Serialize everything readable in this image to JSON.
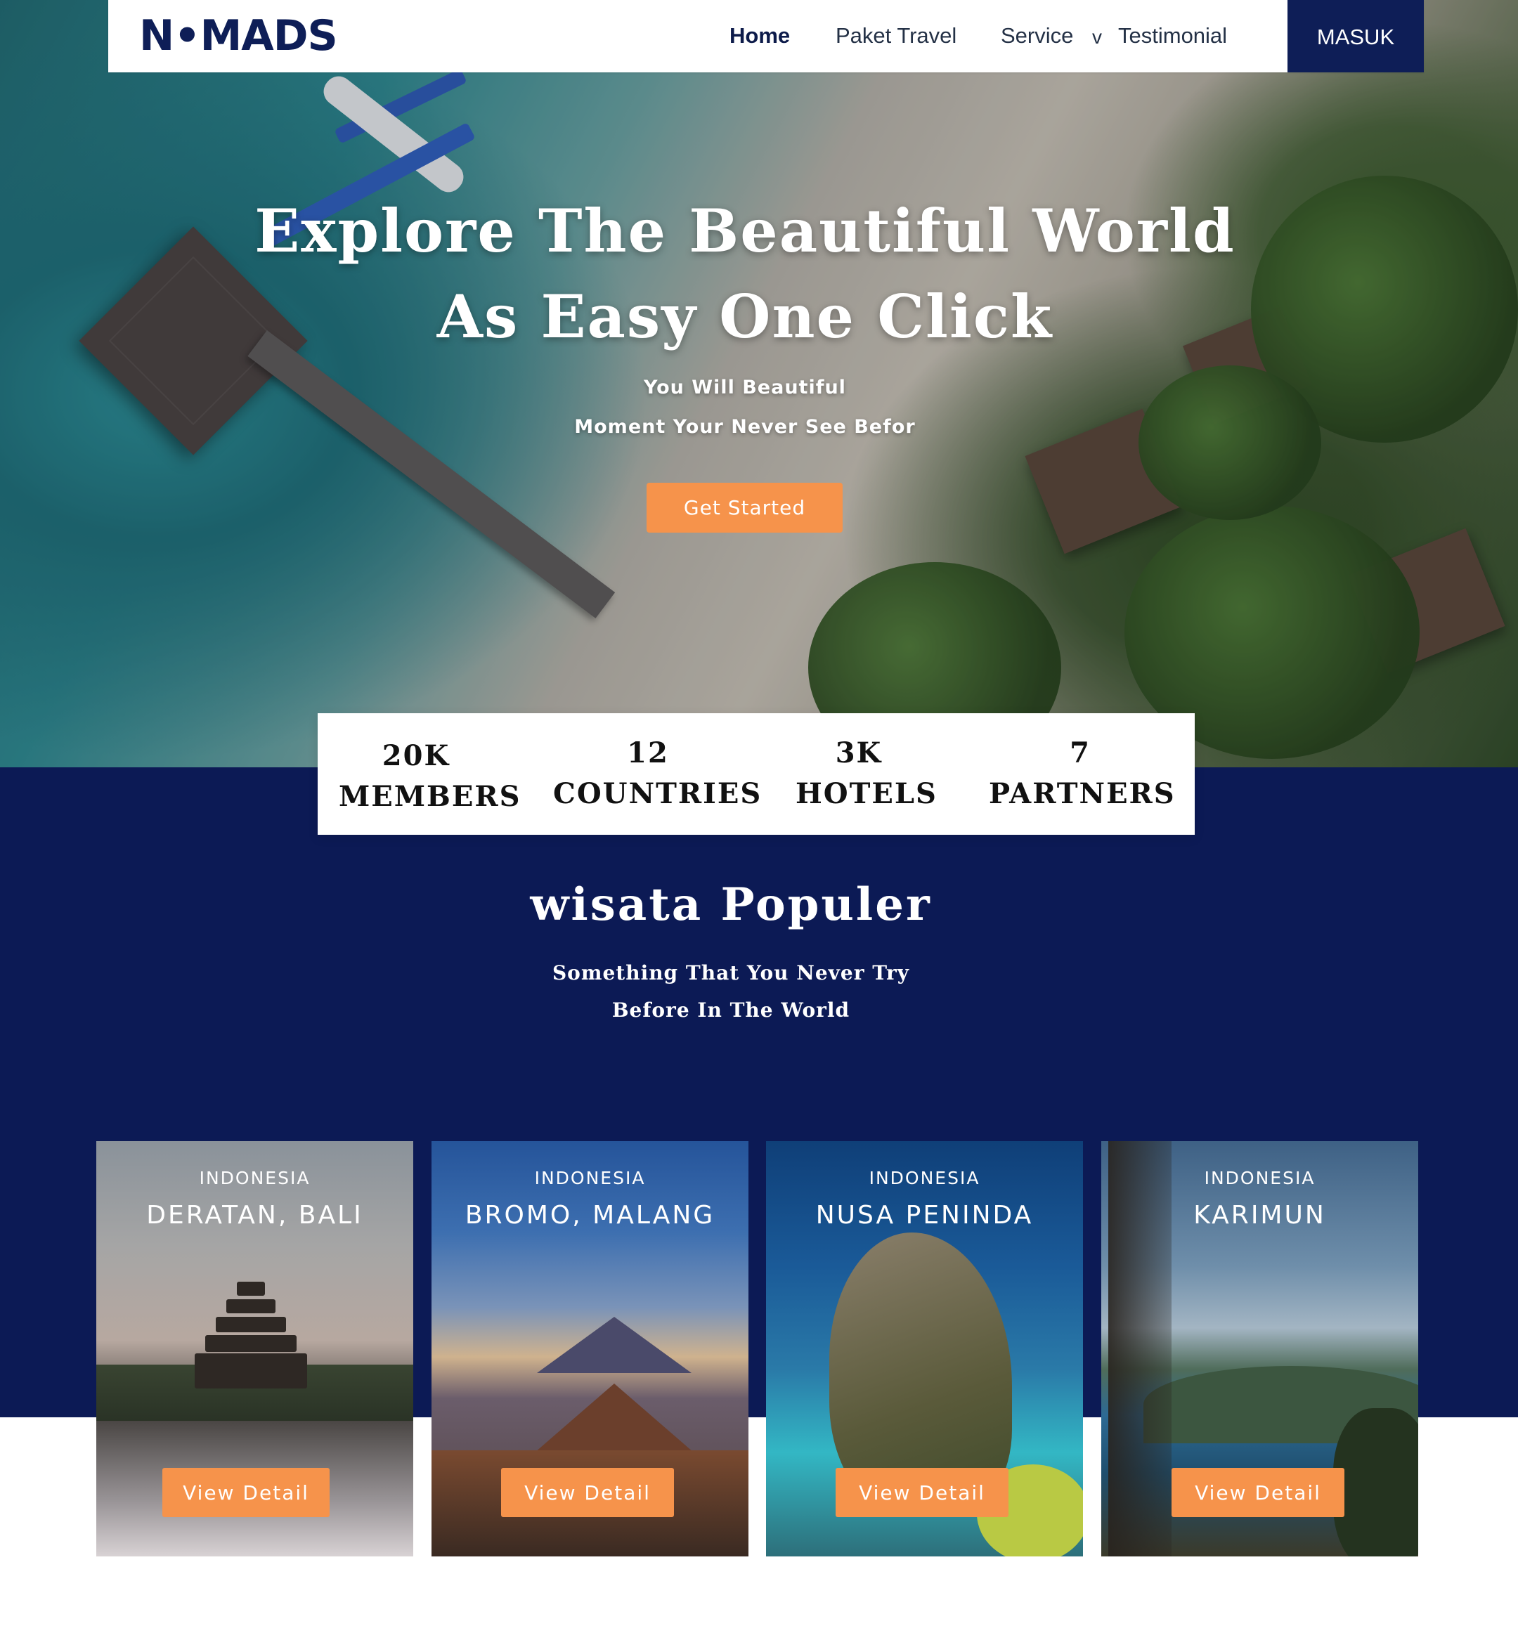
{
  "nav": {
    "logo": "N•MADS",
    "links": [
      "Home",
      "Paket Travel",
      "Service",
      "Testimonial"
    ],
    "caret": "v",
    "login": "MASUK"
  },
  "hero": {
    "title_line1": "Explore The Beautiful World",
    "title_line2": "As Easy One Click",
    "sub_line1": "You Will Beautiful",
    "sub_line2": "Moment Your Never See Befor",
    "cta": "Get Started"
  },
  "stats": [
    {
      "value": "20K",
      "label": "MEMBERS"
    },
    {
      "value": "12",
      "label": "COUNTRIES"
    },
    {
      "value": "3K",
      "label": "HOTELS"
    },
    {
      "value": "7",
      "label": "PARTNERS"
    }
  ],
  "popular": {
    "title": "wisata Populer",
    "sub_line1": "Something That You Never Try",
    "sub_line2": "Before In The World",
    "cards": [
      {
        "country": "INDONESIA",
        "place": "DERATAN, BALI",
        "button": "View Detail"
      },
      {
        "country": "INDONESIA",
        "place": "BROMO, MALANG",
        "button": "View Detail"
      },
      {
        "country": "INDONESIA",
        "place": "NUSA PENINDA",
        "button": "View Detail"
      },
      {
        "country": "INDONESIA",
        "place": "KARIMUN",
        "button": "View Detail"
      }
    ]
  },
  "colors": {
    "navy": "#0c1a55",
    "accent": "#f6934b",
    "logo": "#0e1e57"
  }
}
